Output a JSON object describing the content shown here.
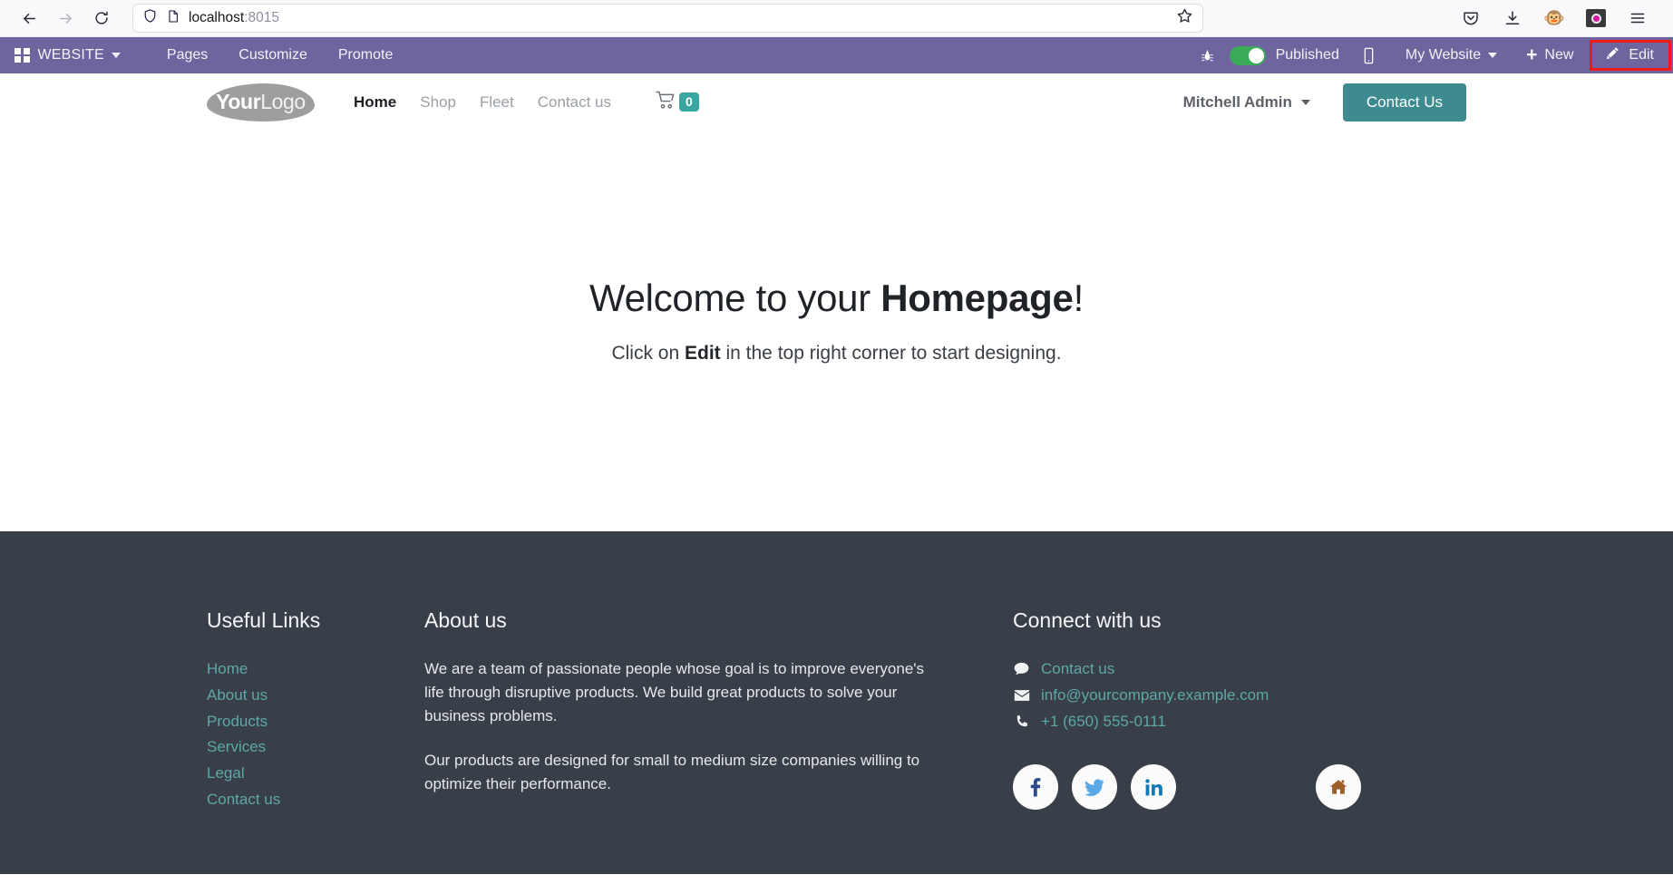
{
  "browser": {
    "back_icon": "back-arrow-icon",
    "forward_icon": "forward-arrow-icon",
    "reload_icon": "reload-icon",
    "shield_icon": "shield-icon",
    "page_icon": "page-document-icon",
    "url_host": "localhost",
    "url_port": ":8015",
    "url_full": "localhost:8015",
    "bookmark_icon": "star-icon",
    "toolbar_icons": [
      "pocket-icon",
      "download-icon",
      "monkey-avatar-icon",
      "extension-icon",
      "hamburger-menu-icon"
    ]
  },
  "odoo_bar": {
    "apps_icon": "apps-grid-icon",
    "brand": "WEBSITE",
    "menu": [
      "Pages",
      "Customize",
      "Promote"
    ],
    "bug_icon": "bug-icon",
    "published_label": "Published",
    "published_state": "on",
    "mobile_icon": "mobile-preview-icon",
    "site_selector": "My Website",
    "new_label": "New",
    "new_icon": "plus-icon",
    "edit_label": "Edit",
    "edit_icon": "pencil-icon",
    "highlight_color": "#ef1a1a",
    "bar_color": "#6f649e"
  },
  "site_header": {
    "logo_bold": "Your",
    "logo_light": "Logo",
    "nav": [
      {
        "label": "Home",
        "active": true
      },
      {
        "label": "Shop",
        "active": false
      },
      {
        "label": "Fleet",
        "active": false
      },
      {
        "label": "Contact us",
        "active": false
      }
    ],
    "cart_icon": "shopping-cart-icon",
    "cart_count": "0",
    "cart_badge_color": "#3aa6a0",
    "user_name": "Mitchell Admin",
    "cta_label": "Contact Us",
    "cta_color": "#3d8b8f"
  },
  "main": {
    "welcome_prefix": "Welcome to your ",
    "welcome_bold": "Homepage",
    "welcome_suffix": "!",
    "sub_prefix": "Click on ",
    "sub_bold": "Edit",
    "sub_suffix": " in the top right corner to start designing."
  },
  "footer": {
    "background": "#383f48",
    "link_color": "#5ea8a8",
    "useful_links": {
      "title": "Useful Links",
      "items": [
        "Home",
        "About us",
        "Products",
        "Services",
        "Legal",
        "Contact us"
      ]
    },
    "about": {
      "title": "About us",
      "paragraph1": "We are a team of passionate people whose goal is to improve everyone's life through disruptive products. We build great products to solve your business problems.",
      "paragraph2": "Our products are designed for small to medium size companies willing to optimize their performance."
    },
    "connect": {
      "title": "Connect with us",
      "rows": [
        {
          "icon": "comment-icon",
          "label": "Contact us"
        },
        {
          "icon": "envelope-icon",
          "label": "info@yourcompany.example.com"
        },
        {
          "icon": "phone-icon",
          "label": "+1 (650) 555-0111"
        }
      ],
      "social": [
        {
          "icon": "facebook-icon",
          "color": "#2b4a8b"
        },
        {
          "icon": "twitter-icon",
          "color": "#5aa9e6"
        },
        {
          "icon": "linkedin-icon",
          "color": "#1179b5"
        },
        {
          "icon": "home-icon",
          "color": "#9a5f2b"
        }
      ]
    }
  }
}
